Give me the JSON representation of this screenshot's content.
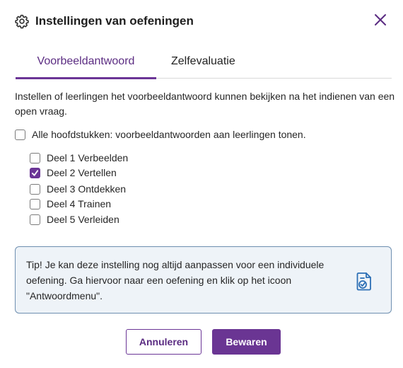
{
  "dialog": {
    "title": "Instellingen van oefeningen",
    "icons": {
      "header": "gear-icon",
      "close": "close-icon",
      "tip": "answer-menu-icon"
    },
    "colors": {
      "accent": "#6b3596",
      "tip_background": "#eef3f8",
      "tip_border": "#6e8fb0"
    }
  },
  "tabs": [
    {
      "label": "Voorbeeldantwoord",
      "active": true
    },
    {
      "label": "Zelfevaluatie",
      "active": false
    }
  ],
  "description": "Instellen of leerlingen het voorbeeldantwoord kunnen bekijken na het indienen van een open vraag.",
  "all_chapters": {
    "label": "Alle hoofdstukken: voorbeeldantwoorden aan leerlingen tonen.",
    "checked": false
  },
  "chapters": [
    {
      "label": "Deel 1 Verbeelden",
      "checked": false
    },
    {
      "label": "Deel 2 Vertellen",
      "checked": true
    },
    {
      "label": "Deel 3 Ontdekken",
      "checked": false
    },
    {
      "label": "Deel 4 Trainen",
      "checked": false
    },
    {
      "label": "Deel 5 Verleiden",
      "checked": false
    }
  ],
  "tip": {
    "text": "Tip! Je kan deze instelling nog altijd aanpassen voor een individuele oefening. Ga hiervoor naar een oefening en klik op het icoon \"Antwoordmenu\"."
  },
  "footer": {
    "cancel_label": "Annuleren",
    "save_label": "Bewaren"
  }
}
